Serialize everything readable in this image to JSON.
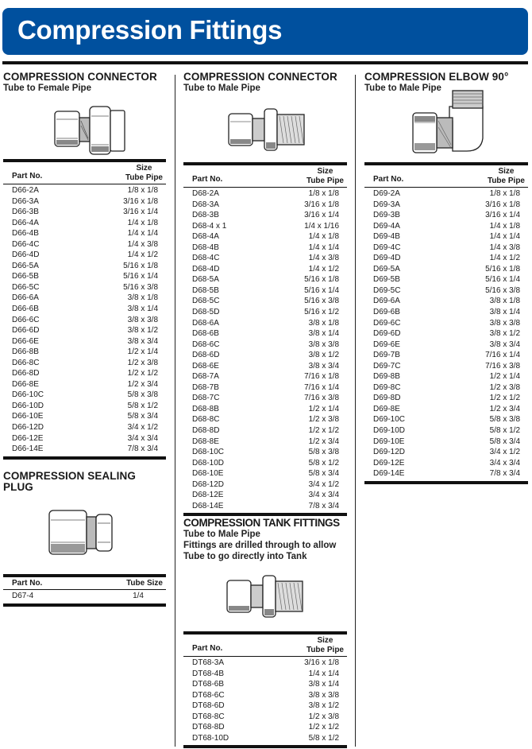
{
  "header": {
    "title": "Compression Fittings",
    "banner_color": "#00509e"
  },
  "sections": {
    "connector_female": {
      "title": "COMPRESSION CONNECTOR",
      "subtitle": "Tube to Female Pipe",
      "illustration": "connector-female-pipe-icon",
      "col_part": "Part No.",
      "col_size_line1": "Size",
      "col_size_line2": "Tube Pipe",
      "rows": [
        {
          "part": "D66-2A",
          "size": "1/8 x 1/8"
        },
        {
          "part": "D66-3A",
          "size": "3/16 x 1/8"
        },
        {
          "part": "D66-3B",
          "size": "3/16 x 1/4"
        },
        {
          "part": "D66-4A",
          "size": "1/4 x 1/8"
        },
        {
          "part": "D66-4B",
          "size": "1/4 x 1/4"
        },
        {
          "part": "D66-4C",
          "size": "1/4 x 3/8"
        },
        {
          "part": "D66-4D",
          "size": "1/4 x 1/2"
        },
        {
          "part": "D66-5A",
          "size": "5/16 x 1/8"
        },
        {
          "part": "D66-5B",
          "size": "5/16 x 1/4"
        },
        {
          "part": "D66-5C",
          "size": "5/16 x 3/8"
        },
        {
          "part": "D66-6A",
          "size": "3/8 x 1/8"
        },
        {
          "part": "D66-6B",
          "size": "3/8 x 1/4"
        },
        {
          "part": "D66-6C",
          "size": "3/8 x 3/8"
        },
        {
          "part": "D66-6D",
          "size": "3/8 x 1/2"
        },
        {
          "part": "D66-6E",
          "size": "3/8 x 3/4"
        },
        {
          "part": "D66-8B",
          "size": "1/2 x 1/4"
        },
        {
          "part": "D66-8C",
          "size": "1/2 x 3/8"
        },
        {
          "part": "D66-8D",
          "size": "1/2 x 1/2"
        },
        {
          "part": "D66-8E",
          "size": "1/2 x 3/4"
        },
        {
          "part": "D66-10C",
          "size": "5/8 x 3/8"
        },
        {
          "part": "D66-10D",
          "size": "5/8 x 1/2"
        },
        {
          "part": "D66-10E",
          "size": "5/8 x 3/4"
        },
        {
          "part": "D66-12D",
          "size": "3/4 x 1/2"
        },
        {
          "part": "D66-12E",
          "size": "3/4 x 3/4"
        },
        {
          "part": "D66-14E",
          "size": "7/8 x 3/4"
        }
      ]
    },
    "sealing_plug": {
      "title_line1": "COMPRESSION SEALING",
      "title_line2": "PLUG",
      "illustration": "sealing-plug-icon",
      "col_part": "Part No.",
      "col_size": "Tube Size",
      "rows": [
        {
          "part": "D67-4",
          "size": "1/4"
        }
      ]
    },
    "connector_male": {
      "title": "COMPRESSION CONNECTOR",
      "subtitle": "Tube to Male Pipe",
      "illustration": "connector-male-pipe-icon",
      "col_part": "Part No.",
      "col_size_line1": "Size",
      "col_size_line2": "Tube Pipe",
      "rows": [
        {
          "part": "D68-2A",
          "size": "1/8 x 1/8"
        },
        {
          "part": "D68-3A",
          "size": "3/16 x 1/8"
        },
        {
          "part": "D68-3B",
          "size": "3/16 x 1/4"
        },
        {
          "part": "D68-4 x 1",
          "size": "1/4 x 1/16"
        },
        {
          "part": "D68-4A",
          "size": "1/4 x 1/8"
        },
        {
          "part": "D68-4B",
          "size": "1/4 x 1/4"
        },
        {
          "part": "D68-4C",
          "size": "1/4 x 3/8"
        },
        {
          "part": "D68-4D",
          "size": "1/4 x 1/2"
        },
        {
          "part": "D68-5A",
          "size": "5/16 x 1/8"
        },
        {
          "part": "D68-5B",
          "size": "5/16 x 1/4"
        },
        {
          "part": "D68-5C",
          "size": "5/16 x 3/8"
        },
        {
          "part": "D68-5D",
          "size": "5/16 x 1/2"
        },
        {
          "part": "D68-6A",
          "size": "3/8 x 1/8"
        },
        {
          "part": "D68-6B",
          "size": "3/8 x 1/4"
        },
        {
          "part": "D68-6C",
          "size": "3/8 x 3/8"
        },
        {
          "part": "D68-6D",
          "size": "3/8 x 1/2"
        },
        {
          "part": "D68-6E",
          "size": "3/8 x 3/4"
        },
        {
          "part": "D68-7A",
          "size": "7/16 x 1/8"
        },
        {
          "part": "D68-7B",
          "size": "7/16 x 1/4"
        },
        {
          "part": "D68-7C",
          "size": "7/16 x 3/8"
        },
        {
          "part": "D68-8B",
          "size": "1/2 x 1/4"
        },
        {
          "part": "D68-8C",
          "size": "1/2 x 3/8"
        },
        {
          "part": "D68-8D",
          "size": "1/2 x 1/2"
        },
        {
          "part": "D68-8E",
          "size": "1/2 x 3/4"
        },
        {
          "part": "D68-10C",
          "size": "5/8 x 3/8"
        },
        {
          "part": "D68-10D",
          "size": "5/8 x 1/2"
        },
        {
          "part": "D68-10E",
          "size": "5/8 x 3/4"
        },
        {
          "part": "D68-12D",
          "size": "3/4 x 1/2"
        },
        {
          "part": "D68-12E",
          "size": "3/4 x 3/4"
        },
        {
          "part": "D68-14E",
          "size": "7/8 x 3/4"
        }
      ]
    },
    "tank_fittings": {
      "title": "COMPRESSION TANK FITTINGS",
      "subtitle": "Tube to Male Pipe",
      "note_line1": "Fittings are drilled through to allow",
      "note_line2": "Tube to go directly into Tank",
      "illustration": "tank-fitting-icon",
      "col_part": "Part No.",
      "col_size_line1": "Size",
      "col_size_line2": "Tube Pipe",
      "rows": [
        {
          "part": "DT68-3A",
          "size": "3/16 x 1/8"
        },
        {
          "part": "DT68-4B",
          "size": "1/4 x 1/4"
        },
        {
          "part": "DT68-6B",
          "size": "3/8 x 1/4"
        },
        {
          "part": "DT68-6C",
          "size": "3/8 x 3/8"
        },
        {
          "part": "DT68-6D",
          "size": "3/8 x 1/2"
        },
        {
          "part": "DT68-8C",
          "size": "1/2 x 3/8"
        },
        {
          "part": "DT68-8D",
          "size": "1/2 x 1/2"
        },
        {
          "part": "DT68-10D",
          "size": "5/8 x 1/2"
        }
      ]
    },
    "elbow_90": {
      "title": "COMPRESSION ELBOW 90°",
      "subtitle": "Tube to Male Pipe",
      "illustration": "elbow-90-icon",
      "col_part": "Part No.",
      "col_size_line1": "Size",
      "col_size_line2": "Tube Pipe",
      "rows": [
        {
          "part": "D69-2A",
          "size": "1/8 x 1/8"
        },
        {
          "part": "D69-3A",
          "size": "3/16 x 1/8"
        },
        {
          "part": "D69-3B",
          "size": "3/16 x 1/4"
        },
        {
          "part": "D69-4A",
          "size": "1/4 x 1/8"
        },
        {
          "part": "D69-4B",
          "size": "1/4 x 1/4"
        },
        {
          "part": "D69-4C",
          "size": "1/4 x 3/8"
        },
        {
          "part": "D69-4D",
          "size": "1/4 x 1/2"
        },
        {
          "part": "D69-5A",
          "size": "5/16 x 1/8"
        },
        {
          "part": "D69-5B",
          "size": "5/16 x 1/4"
        },
        {
          "part": "D69-5C",
          "size": "5/16 x 3/8"
        },
        {
          "part": "D69-6A",
          "size": "3/8 x 1/8"
        },
        {
          "part": "D69-6B",
          "size": "3/8 x 1/4"
        },
        {
          "part": "D69-6C",
          "size": "3/8 x 3/8"
        },
        {
          "part": "D69-6D",
          "size": "3/8 x 1/2"
        },
        {
          "part": "D69-6E",
          "size": "3/8 x 3/4"
        },
        {
          "part": "D69-7B",
          "size": "7/16 x 1/4"
        },
        {
          "part": "D69-7C",
          "size": "7/16 x 3/8"
        },
        {
          "part": "D69-8B",
          "size": "1/2 x 1/4"
        },
        {
          "part": "D69-8C",
          "size": "1/2 x 3/8"
        },
        {
          "part": "D69-8D",
          "size": "1/2 x 1/2"
        },
        {
          "part": "D69-8E",
          "size": "1/2 x 3/4"
        },
        {
          "part": "D69-10C",
          "size": "5/8 x 3/8"
        },
        {
          "part": "D69-10D",
          "size": "5/8 x 1/2"
        },
        {
          "part": "D69-10E",
          "size": "5/8 x 3/4"
        },
        {
          "part": "D69-12D",
          "size": "3/4 x 1/2"
        },
        {
          "part": "D69-12E",
          "size": "3/4 x 3/4"
        },
        {
          "part": "D69-14E",
          "size": "7/8 x 3/4"
        }
      ]
    }
  }
}
